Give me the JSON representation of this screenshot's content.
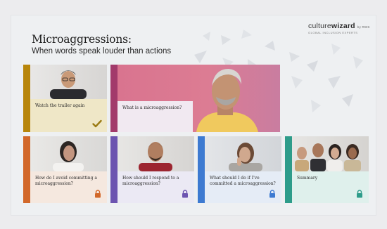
{
  "header": {
    "title": "Microaggressions:",
    "subtitle": "When words speak louder than actions"
  },
  "logo": {
    "brand_light": "culture",
    "brand_bold": "wizard",
    "by": "by RWS",
    "tagline": "GLOBAL INCLUSION EXPERTS"
  },
  "tiles": [
    {
      "label": "Watch the trailer again",
      "status": "completed",
      "status_icon": "checkmark-icon",
      "accent": "#b8860b"
    },
    {
      "label": "What is a microaggression?",
      "status": "available",
      "status_icon": "",
      "accent": "#a23a6b"
    },
    {
      "label": "How do I avoid committing a microaggression?",
      "status": "locked",
      "status_icon": "lock-icon",
      "accent": "#d2682a"
    },
    {
      "label": "How should I respond to a microaggression?",
      "status": "locked",
      "status_icon": "lock-icon",
      "accent": "#6c54b0"
    },
    {
      "label": "What should I do if I've committed a microaggression?",
      "status": "locked",
      "status_icon": "lock-icon",
      "accent": "#3d7ad1"
    },
    {
      "label": "Summary",
      "status": "locked",
      "status_icon": "lock-icon",
      "accent": "#2e9c8a"
    }
  ],
  "colors": {
    "background": "#eef0f2",
    "tile1_label_bg": "#efe7c7",
    "tile2_label_bg": "#f1e9f1",
    "tile3_label_bg": "#f5e8df",
    "tile4_label_bg": "#ebe9f4",
    "tile5_label_bg": "#e5ecf6",
    "tile6_label_bg": "#dff0ec",
    "check_color": "#9a7a12",
    "lock_orange": "#d2682a",
    "lock_purple": "#6c54b0",
    "lock_blue": "#3d7ad1",
    "lock_teal": "#2e9c8a"
  }
}
